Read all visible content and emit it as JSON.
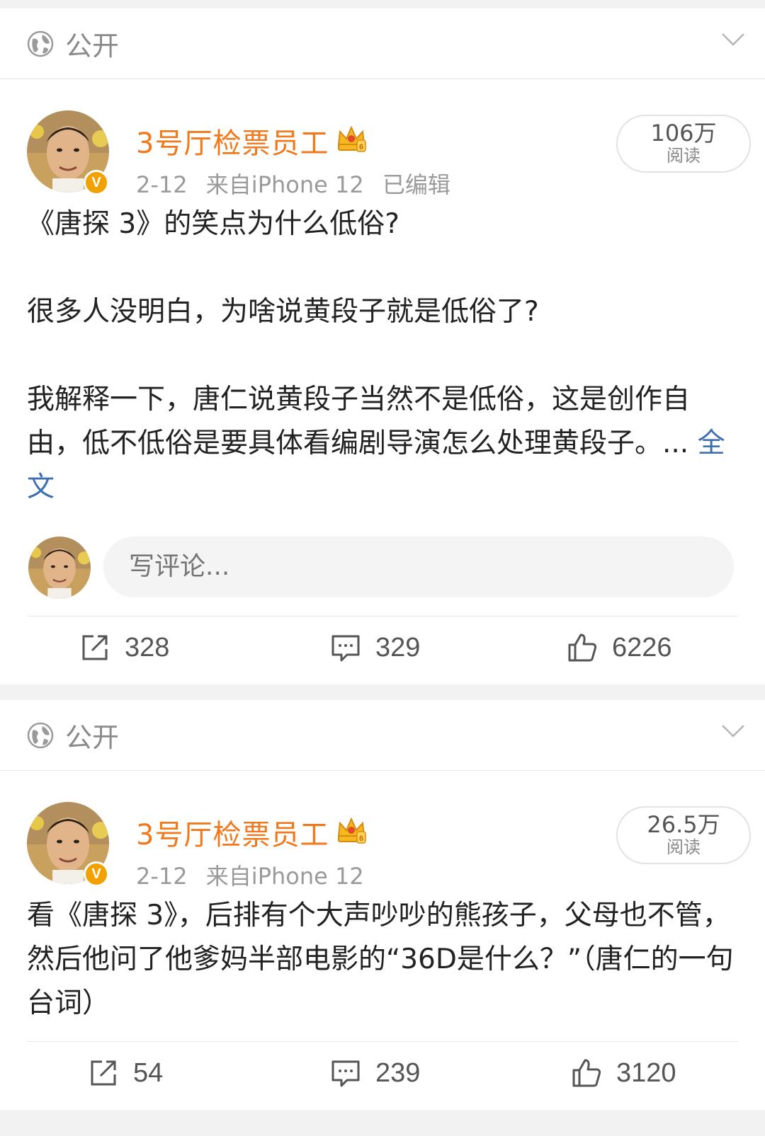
{
  "posts": [
    {
      "visibility": "公开",
      "author": "3号厅检票员工",
      "badge": "V",
      "date": "2-12",
      "source": "来自iPhone 12",
      "edited": "已编辑",
      "reads_num": "106万",
      "reads_label": "阅读",
      "paragraphs": [
        "《唐探 3》的笑点为什么低俗?",
        "很多人没明白，为啥说黄段子就是低俗了?",
        "我解释一下，唐仁说黄段子当然不是低俗，这是创作自由，低不低俗是要具体看编剧导演怎么处理黄段子。..."
      ],
      "more_link": "全文",
      "comment_placeholder": "写评论...",
      "reposts": "328",
      "comments": "329",
      "likes": "6226"
    },
    {
      "visibility": "公开",
      "author": "3号厅检票员工",
      "badge": "V",
      "date": "2-12",
      "source": "来自iPhone 12",
      "reads_num": "26.5万",
      "reads_label": "阅读",
      "paragraphs": [
        "看《唐探 3》，后排有个大声吵吵的熊孩子，父母也不管，然后他问了他爹妈半部电影的“36D是什么？”（唐仁的一句台词）"
      ],
      "reposts": "54",
      "comments": "239",
      "likes": "3120"
    }
  ]
}
